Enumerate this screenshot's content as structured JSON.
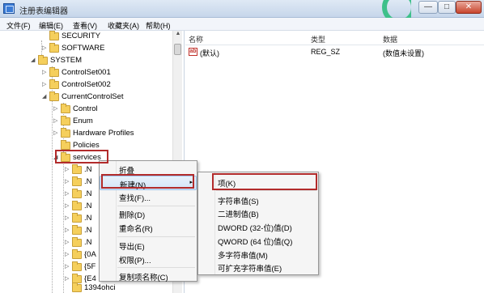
{
  "window": {
    "title": "注册表编辑器",
    "min": "—",
    "max": "□",
    "close": "✕"
  },
  "menubar": [
    "文件(F)",
    "编辑(E)",
    "查看(V)",
    "收藏夹(A)",
    "帮助(H)"
  ],
  "tree": {
    "items": [
      {
        "label": "SECURITY",
        "arrow": ""
      },
      {
        "label": "SOFTWARE",
        "arrow": "▷"
      },
      {
        "label": "SYSTEM",
        "arrow": "◢"
      },
      {
        "label": "ControlSet001",
        "arrow": "▷"
      },
      {
        "label": "ControlSet002",
        "arrow": "▷"
      },
      {
        "label": "CurrentControlSet",
        "arrow": "◢"
      },
      {
        "label": "Control",
        "arrow": "▷"
      },
      {
        "label": "Enum",
        "arrow": "▷"
      },
      {
        "label": "Hardware Profiles",
        "arrow": "▷"
      },
      {
        "label": "Policies",
        "arrow": ""
      },
      {
        "label": "services",
        "arrow": "◢"
      },
      {
        "label": ".N",
        "arrow": "▷"
      },
      {
        "label": ".N",
        "arrow": "▷"
      },
      {
        "label": ".N",
        "arrow": "▷"
      },
      {
        "label": ".N",
        "arrow": "▷"
      },
      {
        "label": ".N",
        "arrow": "▷"
      },
      {
        "label": ".N",
        "arrow": "▷"
      },
      {
        "label": ".N",
        "arrow": "▷"
      },
      {
        "label": "{0A",
        "arrow": "▷"
      },
      {
        "label": "{5F",
        "arrow": "▷"
      },
      {
        "label": "{E4",
        "arrow": "▷"
      },
      {
        "label": "1394ohci",
        "arrow": ""
      }
    ]
  },
  "list": {
    "headers": {
      "name": "名称",
      "type": "类型",
      "data": "数据"
    },
    "rows": [
      {
        "icon": "ab",
        "name": "(默认)",
        "type": "REG_SZ",
        "data": "(数值未设置)"
      }
    ]
  },
  "context_menu": {
    "items": [
      "折叠",
      "新建(N)",
      "查找(F)...",
      "删除(D)",
      "重命名(R)",
      "导出(E)",
      "权限(P)...",
      "复制项名称(C)"
    ]
  },
  "submenu": {
    "items": [
      "项(K)",
      "字符串值(S)",
      "二进制值(B)",
      "DWORD (32-位)值(D)",
      "QWORD (64 位)值(Q)",
      "多字符串值(M)",
      "可扩充字符串值(E)"
    ]
  },
  "icons": {
    "submenu_arrow": "▸",
    "scroll_up": "▲"
  },
  "colors": {
    "highlight": "#b22b2b",
    "accent": "#3a7bd5"
  }
}
